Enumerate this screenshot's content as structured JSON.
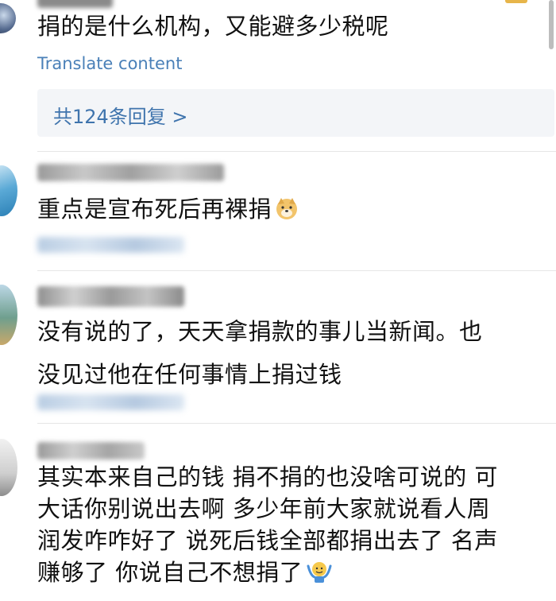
{
  "comments": [
    {
      "text_lines": [
        "捐的是什么机构，又能避多少税呢"
      ],
      "translate": "Translate content",
      "reply_summary": "共124条回复 >"
    },
    {
      "text_lines": [
        "重点是宣布死后再裸捐"
      ],
      "emoji": "doge-emoji"
    },
    {
      "text_lines": [
        "没有说的了，天天拿捐款的事儿当新闻。也",
        "没见过他在任何事情上捐过钱"
      ]
    },
    {
      "text_lines": [
        "其实本来自己的钱 捐不捐的也没啥可说的 可",
        "大话你别说出去啊 多少年前大家就说看人周",
        "润发咋咋好了 说死后钱全部都捐出去了 名声",
        "赚够了 你说自己不想捐了"
      ],
      "emoji": "shrug-emoji"
    }
  ]
}
